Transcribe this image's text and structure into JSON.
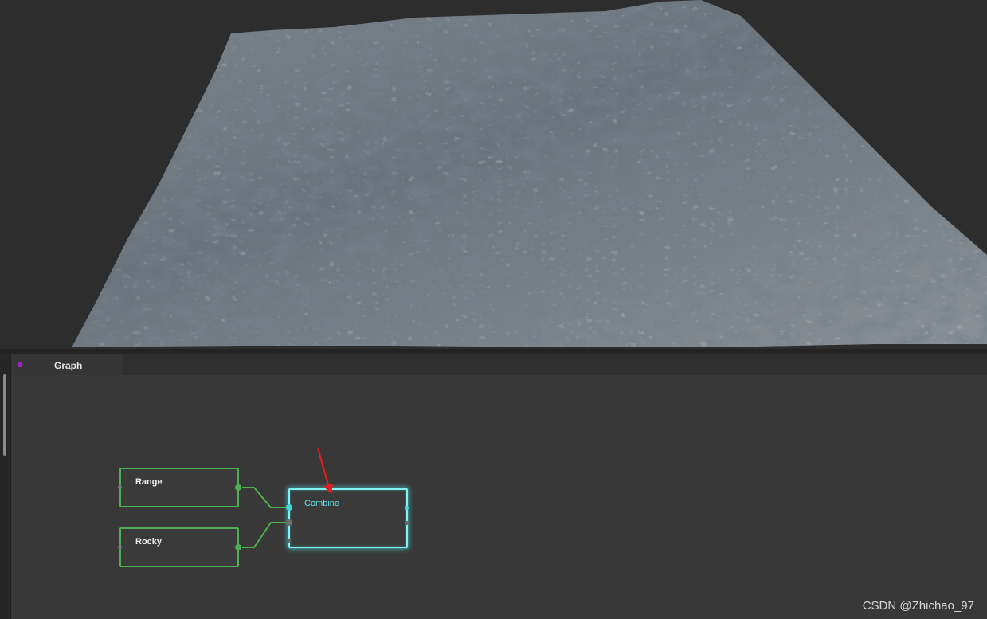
{
  "graph_panel": {
    "tab_label": "Graph",
    "tab_indicator_color": "#a020c0"
  },
  "nodes": {
    "range": {
      "title": "Range"
    },
    "rocky": {
      "title": "Rocky"
    },
    "combine": {
      "title": "Combine"
    }
  },
  "colors": {
    "wire": "#4caf50",
    "selected_node": "#5ee6e6",
    "annotation_arrow": "#e02020"
  },
  "watermark": "CSDN @Zhichao_97"
}
